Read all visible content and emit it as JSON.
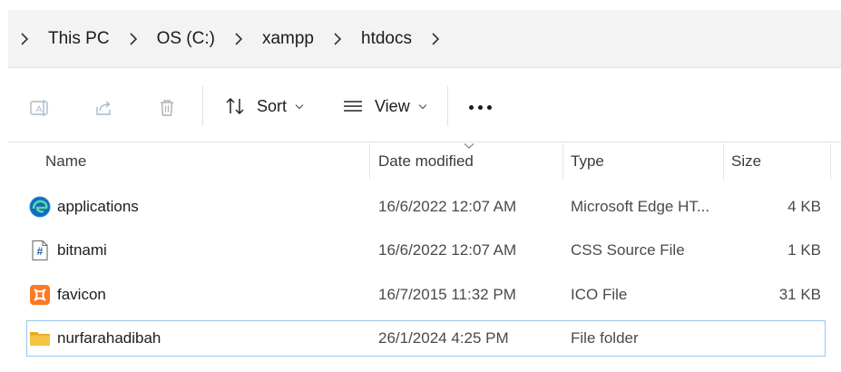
{
  "breadcrumb": {
    "items": [
      {
        "label": "This PC"
      },
      {
        "label": "OS (C:)"
      },
      {
        "label": "xampp"
      },
      {
        "label": "htdocs"
      }
    ]
  },
  "toolbar": {
    "sort_label": "Sort",
    "view_label": "View"
  },
  "columns": {
    "name": "Name",
    "date_modified": "Date modified",
    "type": "Type",
    "size": "Size"
  },
  "files": [
    {
      "name": "applications",
      "date": "16/6/2022 12:07 AM",
      "type": "Microsoft Edge HT...",
      "size": "4 KB",
      "icon": "edge-icon"
    },
    {
      "name": "bitnami",
      "date": "16/6/2022 12:07 AM",
      "type": "CSS Source File",
      "size": "1 KB",
      "icon": "css-file-icon"
    },
    {
      "name": "favicon",
      "date": "16/7/2015 11:32 PM",
      "type": "ICO File",
      "size": "31 KB",
      "icon": "xampp-icon"
    },
    {
      "name": "nurfarahadibah",
      "date": "26/1/2024 4:25 PM",
      "type": "File folder",
      "size": "",
      "icon": "folder-icon"
    }
  ],
  "colors": {
    "selection_border": "#99c6ee",
    "folder": "#f5c542",
    "edge_blue": "#0f6cbd",
    "xampp_orange": "#fb7a24"
  }
}
